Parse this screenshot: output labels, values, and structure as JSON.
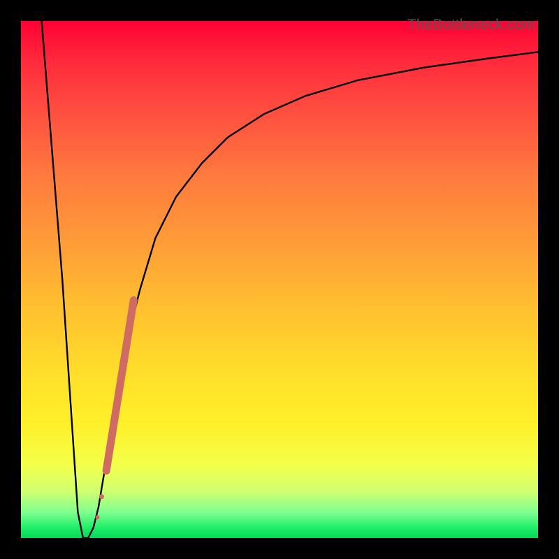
{
  "watermark": "TheBottleneck.com",
  "chart_data": {
    "type": "line",
    "title": "",
    "xlabel": "",
    "ylabel": "",
    "xlim": [
      0,
      100
    ],
    "ylim": [
      0,
      100
    ],
    "series": [
      {
        "name": "bottleneck-curve",
        "x": [
          4,
          8,
          10,
          11,
          12,
          13,
          14,
          15,
          16,
          18,
          20,
          23,
          26,
          30,
          35,
          40,
          47,
          55,
          65,
          78,
          90,
          100
        ],
        "values": [
          100,
          50,
          20,
          5,
          0,
          0,
          2,
          6,
          12,
          24,
          36,
          48,
          58,
          66,
          72.5,
          77.5,
          82,
          85.5,
          88.5,
          91,
          92.7,
          94
        ]
      }
    ],
    "highlight_segment": {
      "name": "dotted-highlight",
      "x": [
        14.8,
        15.6,
        16.5,
        20.7,
        21.8
      ],
      "values": [
        4,
        8,
        13,
        39,
        46
      ]
    },
    "colors": {
      "curve": "#000000",
      "highlight": "#cf6b61",
      "background_top": "#ff0033",
      "background_bottom": "#05d85a",
      "frame": "#000000",
      "watermark": "#555555"
    }
  }
}
